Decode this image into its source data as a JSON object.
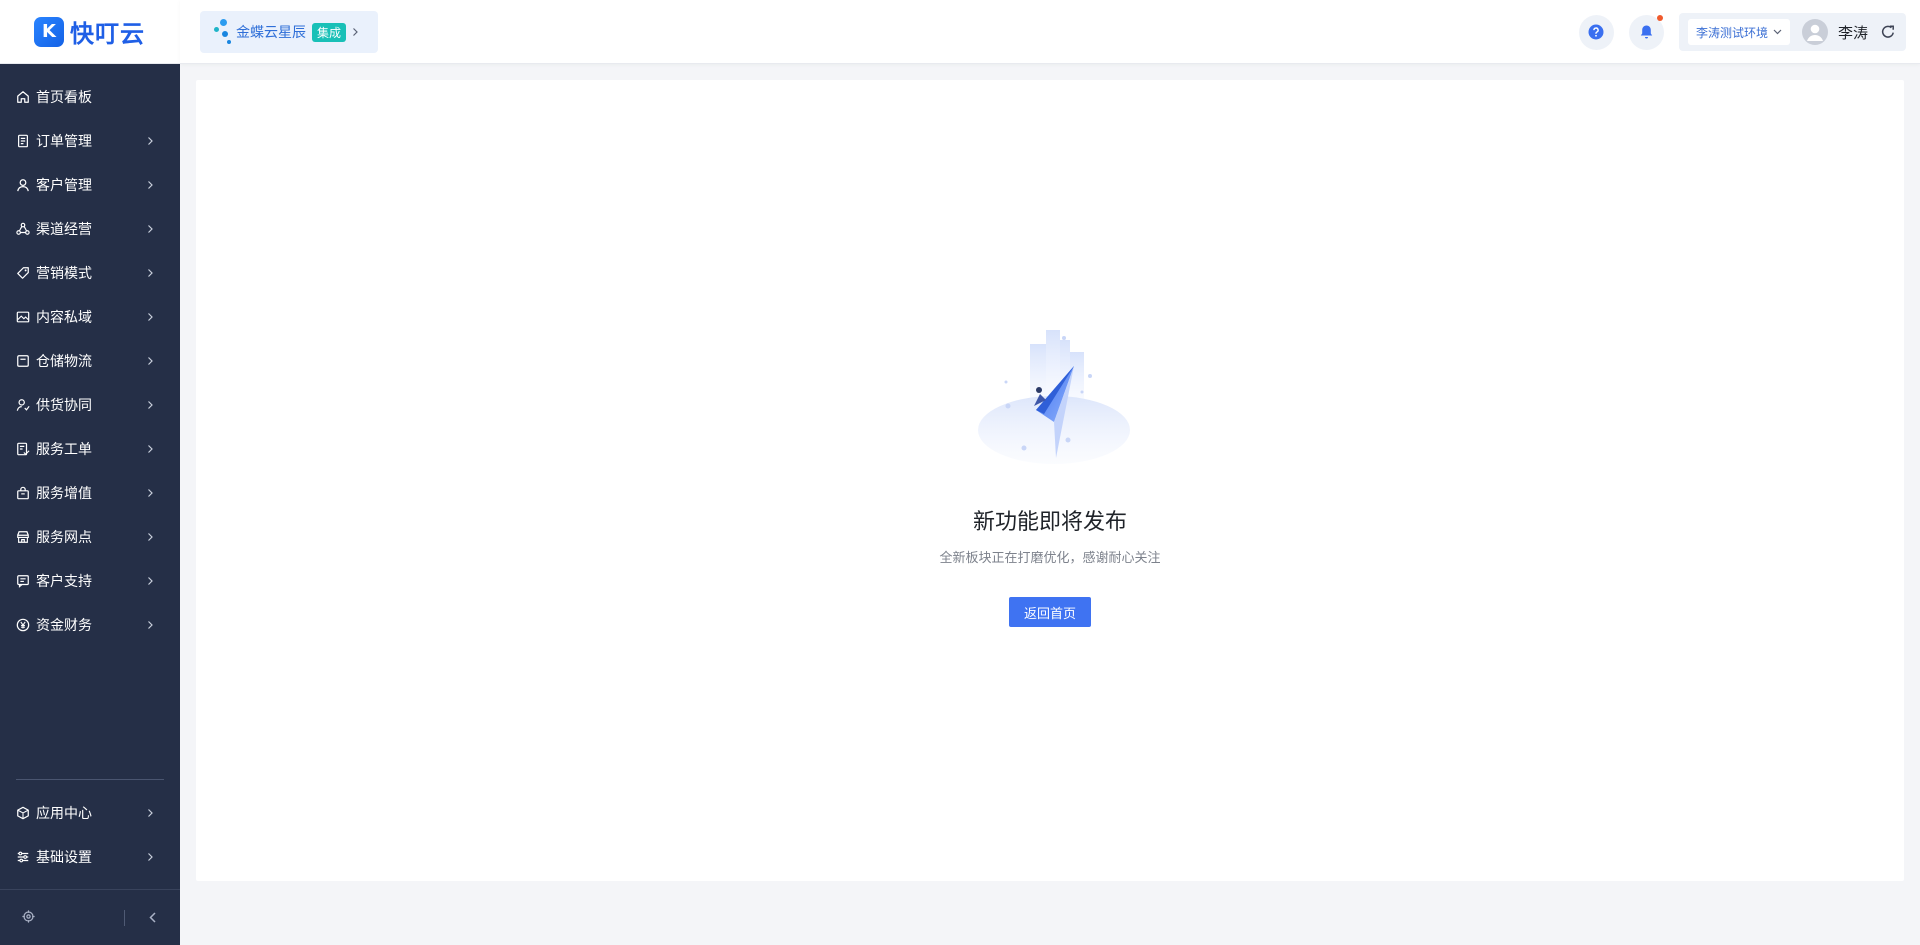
{
  "app": {
    "logo_mark": "K",
    "logo_text": "快叮云"
  },
  "sidebar": {
    "items": [
      {
        "label": "首页看板",
        "icon": "home-icon",
        "has_arrow": false
      },
      {
        "label": "订单管理",
        "icon": "order-icon",
        "has_arrow": true
      },
      {
        "label": "客户管理",
        "icon": "user-icon",
        "has_arrow": true
      },
      {
        "label": "渠道经营",
        "icon": "channel-icon",
        "has_arrow": true
      },
      {
        "label": "营销模式",
        "icon": "tag-icon",
        "has_arrow": true
      },
      {
        "label": "内容私域",
        "icon": "image-icon",
        "has_arrow": true
      },
      {
        "label": "仓储物流",
        "icon": "box-icon",
        "has_arrow": true
      },
      {
        "label": "供货协同",
        "icon": "supply-icon",
        "has_arrow": true
      },
      {
        "label": "服务工单",
        "icon": "ticket-icon",
        "has_arrow": true
      },
      {
        "label": "服务增值",
        "icon": "bag-icon",
        "has_arrow": true
      },
      {
        "label": "服务网点",
        "icon": "store-icon",
        "has_arrow": true
      },
      {
        "label": "客户支持",
        "icon": "support-icon",
        "has_arrow": true
      },
      {
        "label": "资金财务",
        "icon": "yuan-icon",
        "has_arrow": true
      }
    ],
    "bottom_items": [
      {
        "label": "应用中心",
        "icon": "cube-icon",
        "has_arrow": true
      },
      {
        "label": "基础设置",
        "icon": "settings-sliders-icon",
        "has_arrow": true
      }
    ]
  },
  "header": {
    "integration": {
      "name": "金蝶云星辰",
      "badge": "集成"
    },
    "environment": "李涛测试环境",
    "user_name": "李涛"
  },
  "main": {
    "empty_title": "新功能即将发布",
    "empty_desc": "全新板块正在打磨优化，感谢耐心关注",
    "button_label": "返回首页"
  },
  "colors": {
    "sidebar_bg": "#252f47",
    "accent": "#3f73f2",
    "badge": "#19c0b7",
    "notification": "#f05a2c"
  }
}
